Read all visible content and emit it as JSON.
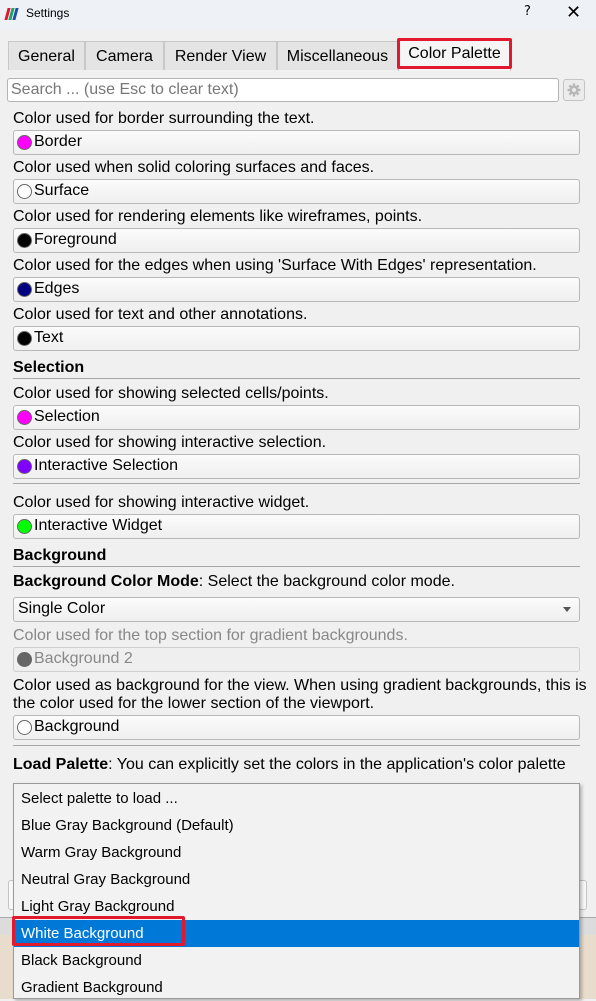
{
  "window": {
    "title": "Settings",
    "help_label": "?",
    "close_label": "✕",
    "logo_colors": [
      "#e2182f",
      "#21a366",
      "#1f4ea8"
    ]
  },
  "tabs": [
    {
      "label": "General",
      "active": false
    },
    {
      "label": "Camera",
      "active": false
    },
    {
      "label": "Render View",
      "active": false
    },
    {
      "label": "Miscellaneous",
      "active": false
    },
    {
      "label": "Color Palette",
      "active": true
    }
  ],
  "search": {
    "placeholder": "Search ... (use Esc to clear text)",
    "value": "",
    "advanced_icon": "gear-icon"
  },
  "general_colors": [
    {
      "description": "Color used for border surrounding the text.",
      "label": "Border",
      "color": "#ff00ff"
    },
    {
      "description": "Color used when solid coloring surfaces and faces.",
      "label": "Surface",
      "color": "#ffffff"
    },
    {
      "description": "Color used for rendering elements like wireframes, points.",
      "label": "Foreground",
      "color": "#000000"
    },
    {
      "description": "Color used for the edges when using 'Surface With Edges' representation.",
      "label": "Edges",
      "color": "#000080"
    },
    {
      "description": "Color used for text and other annotations.",
      "label": "Text",
      "color": "#000000"
    }
  ],
  "selection": {
    "header": "Selection",
    "items": [
      {
        "description": "Color used for showing selected cells/points.",
        "label": "Selection",
        "color": "#ff00ff"
      },
      {
        "description": "Color used for showing interactive selection.",
        "label": "Interactive Selection",
        "color": "#8000ff"
      },
      {
        "description": "Color used for showing interactive widget.",
        "label": "Interactive Widget",
        "color": "#00ff00"
      }
    ]
  },
  "background": {
    "header": "Background",
    "mode_label_bold": "Background Color Mode",
    "mode_label_rest": ": Select the background color mode.",
    "mode_value": "Single Color",
    "background2": {
      "description": "Color used for the top section for gradient backgrounds.",
      "label": "Background 2",
      "color": "#666666",
      "disabled": true
    },
    "background": {
      "description": "Color used as background for the view. When using gradient backgrounds, this is the color used for the lower section of the viewport.",
      "label": "Background",
      "color": "#ffffff"
    }
  },
  "load_palette": {
    "label_bold": "Load Palette",
    "label_rest": ": You can explicitly set the colors in the application's color palette",
    "options": [
      "Select palette to load ...",
      "Blue Gray Background (Default)",
      "Warm Gray Background",
      "Neutral Gray Background",
      "Light Gray Background",
      "White Background",
      "Black Background",
      "Gradient Background"
    ],
    "highlighted_index": 5,
    "highlight_color": "#0078d7",
    "annotation_color": "#e2182f"
  }
}
